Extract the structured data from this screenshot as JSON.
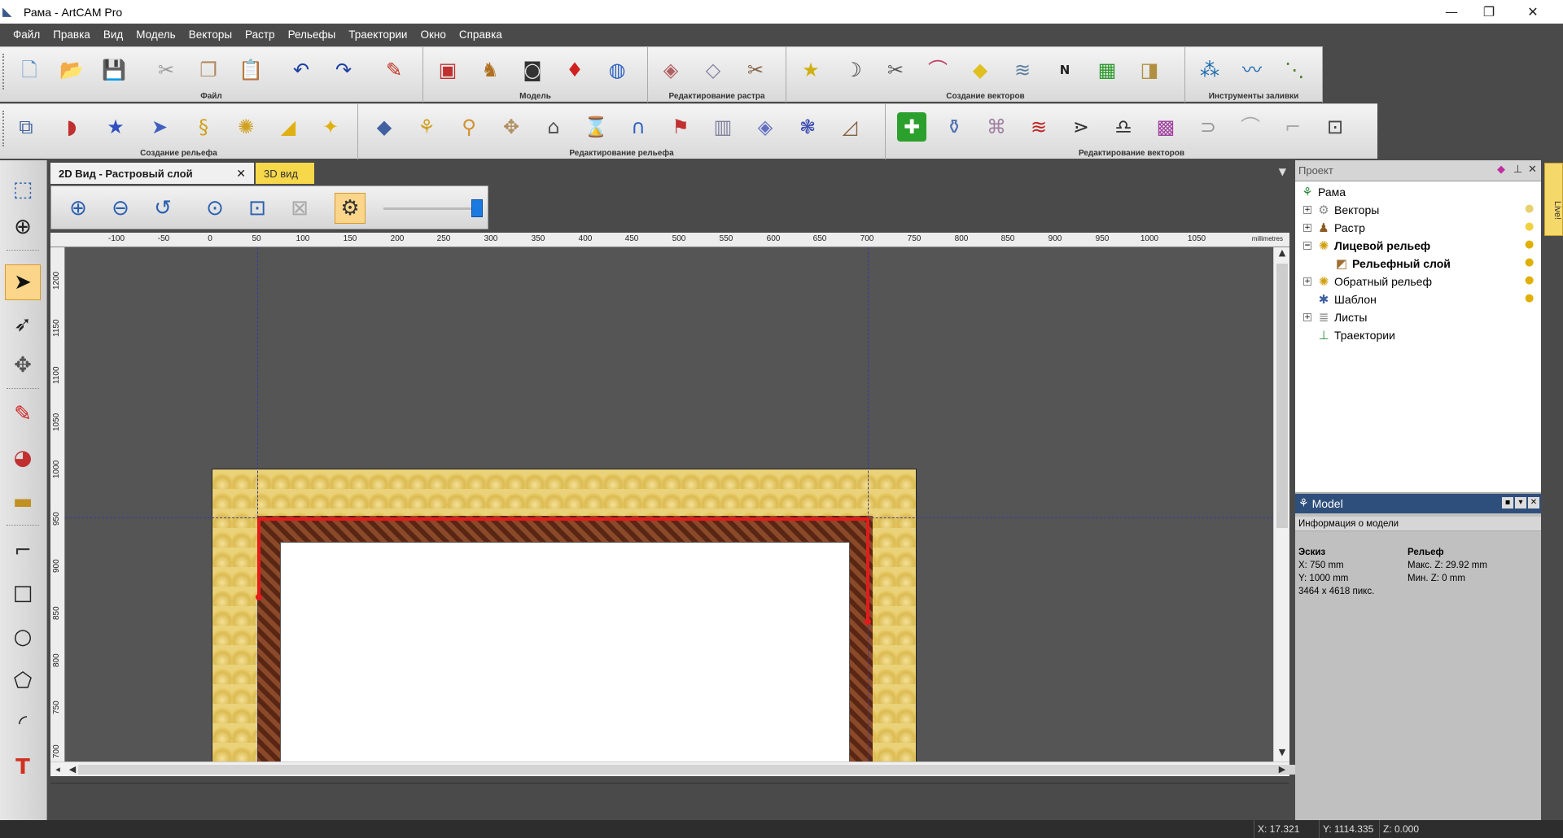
{
  "window": {
    "title": "Рама - ArtCAM Pro",
    "icon": "artcam-logo-icon",
    "minimize": "—",
    "maximize": "❐",
    "close": "✕"
  },
  "menu": [
    "Файл",
    "Правка",
    "Вид",
    "Модель",
    "Векторы",
    "Растр",
    "Рельефы",
    "Траектории",
    "Окно",
    "Справка"
  ],
  "toolbar_groups": {
    "file": "Файл",
    "model": "Модель",
    "raster_edit": "Редактирование растра",
    "vector_create": "Создание векторов",
    "fill_tools": "Инструменты заливки",
    "relief_create": "Создание рельефа",
    "relief_edit": "Редактирование рельефа",
    "vector_edit": "Редактирование векторов"
  },
  "tabs": {
    "view2d": "2D Вид - Растровый слой",
    "view2d_close": "✕",
    "view3d": "3D вид"
  },
  "ruler_h": {
    "unit": "millimetres",
    "ticks": [
      "-100",
      "-50",
      "0",
      "50",
      "100",
      "150",
      "200",
      "250",
      "300",
      "350",
      "400",
      "450",
      "500",
      "550",
      "600",
      "650",
      "700",
      "750",
      "800",
      "850",
      "900",
      "950",
      "1000",
      "1050"
    ]
  },
  "ruler_v": {
    "ticks": [
      "1200",
      "1150",
      "1100",
      "1050",
      "1000",
      "950",
      "900",
      "850",
      "800",
      "750",
      "700"
    ]
  },
  "project_panel": {
    "title": "Проект",
    "items": [
      {
        "label": "Рама",
        "icon": "project-root-icon"
      },
      {
        "label": "Векторы",
        "icon": "vectors-icon"
      },
      {
        "label": "Растр",
        "icon": "raster-icon"
      },
      {
        "label": "Лицевой рельеф",
        "icon": "relief-icon"
      },
      {
        "label": "Рельефный слой",
        "icon": "relief-layer-icon"
      },
      {
        "label": "Обратный рельеф",
        "icon": "relief-icon"
      },
      {
        "label": "Шаблон",
        "icon": "template-icon"
      },
      {
        "label": "Листы",
        "icon": "sheets-icon"
      },
      {
        "label": "Траектории",
        "icon": "toolpaths-icon"
      }
    ]
  },
  "model_panel": {
    "title": "Model",
    "subtitle": "Информация о модели",
    "sketch": {
      "heading": "Эскиз",
      "x": "X: 750 mm",
      "y": "Y: 1000 mm",
      "pixels": "3464 x 4618 пикс."
    },
    "relief": {
      "heading": "Рельеф",
      "max_z": "Макс. Z: 29.92 mm",
      "min_z": "Мин. Z: 0 mm"
    }
  },
  "live_tab": "Live!",
  "status": {
    "x": "X: 17.321",
    "y": "Y: 1114.335",
    "z": "Z: 0.000"
  },
  "colors": {
    "accent": "#2e4f7c",
    "active_tool": "#fbd68a",
    "path": "#e31b1b",
    "tab3d": "#f6d84a"
  }
}
